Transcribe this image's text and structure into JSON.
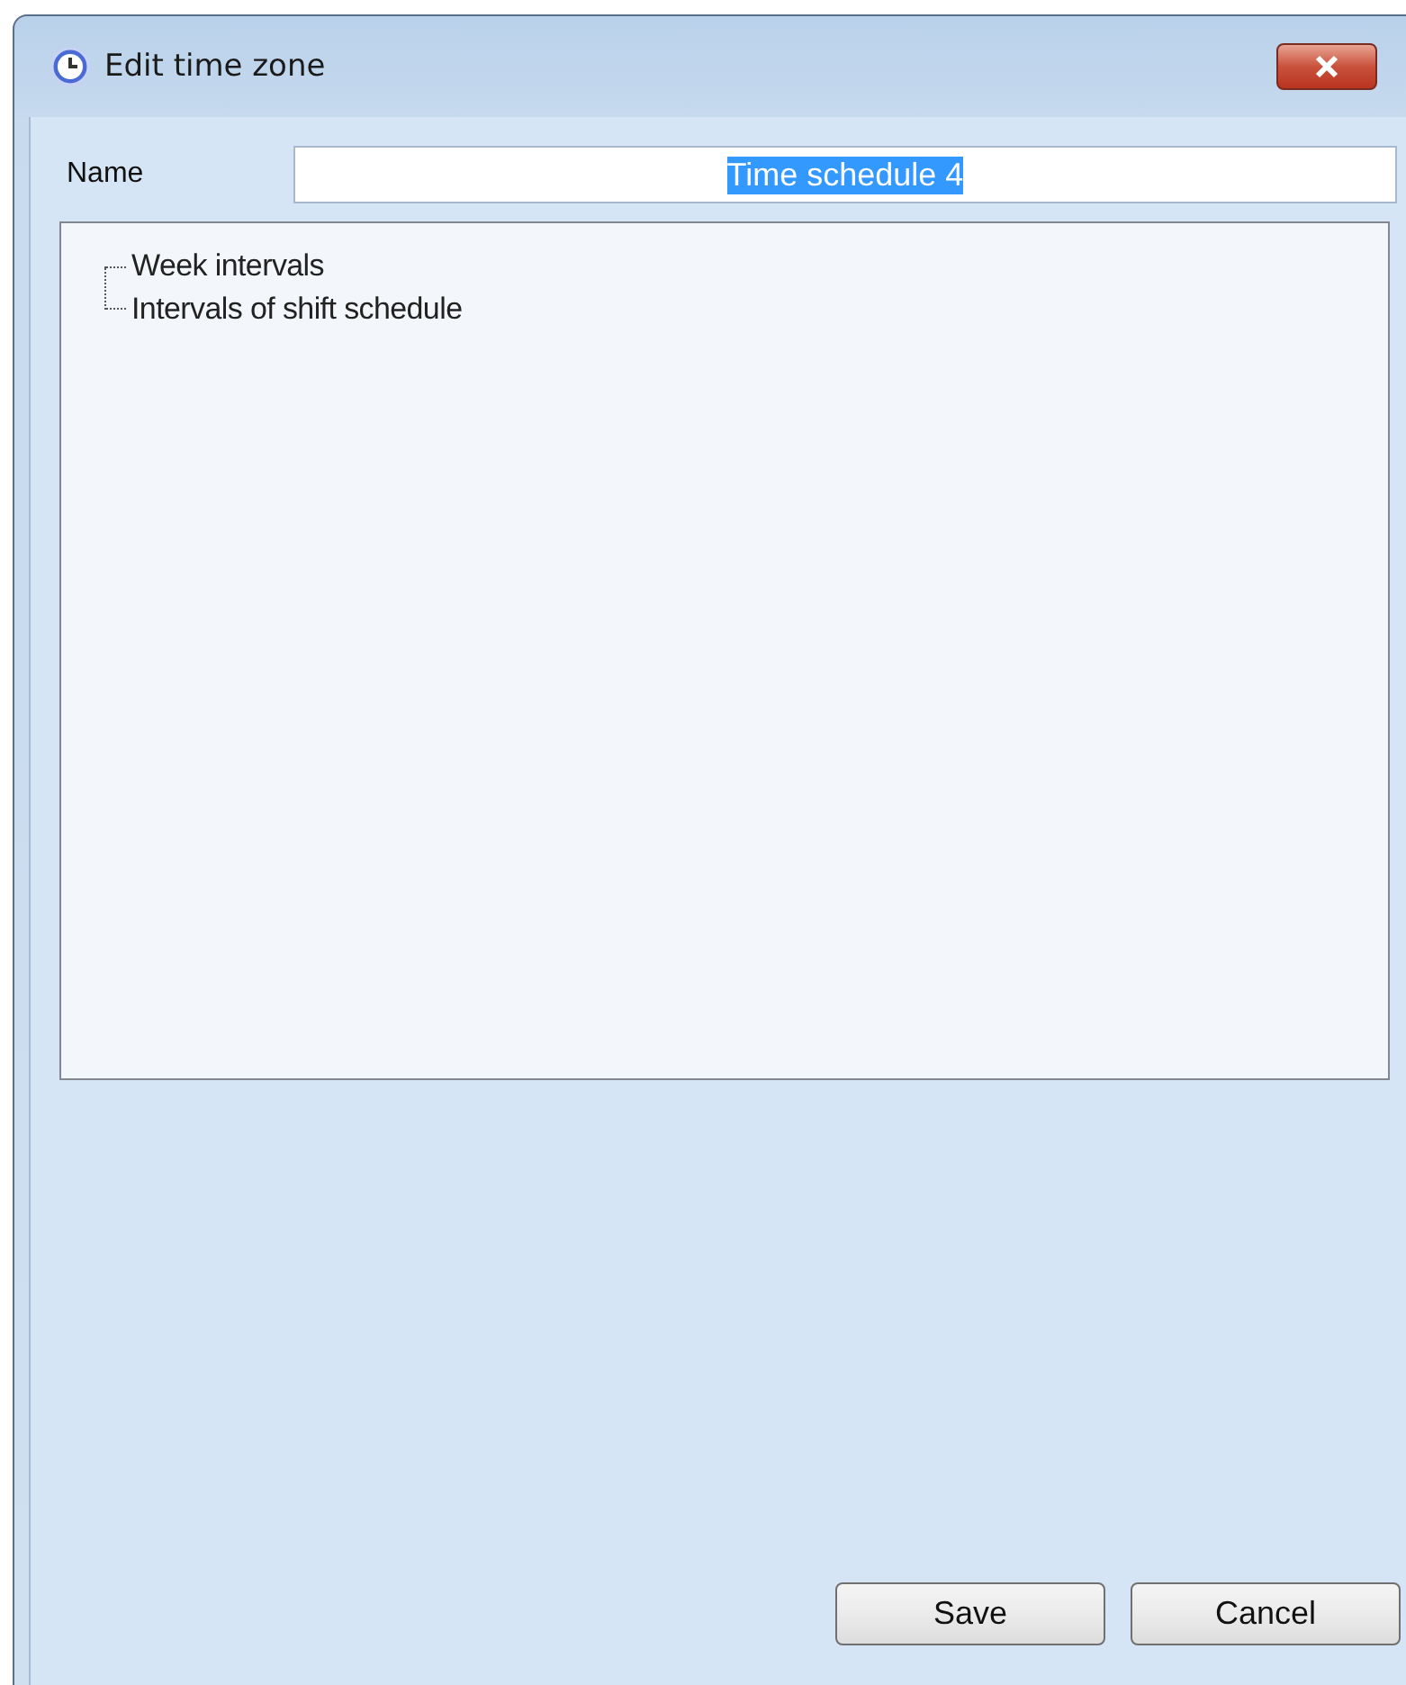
{
  "window": {
    "title": "Edit time zone"
  },
  "name_field": {
    "label": "Name",
    "value": "Time schedule 4",
    "value_selected": true
  },
  "tree": {
    "items": [
      {
        "label": "Week intervals"
      },
      {
        "label": "Intervals of shift schedule"
      }
    ]
  },
  "buttons": [
    {
      "label": "Save"
    },
    {
      "label": "Cancel"
    }
  ]
}
